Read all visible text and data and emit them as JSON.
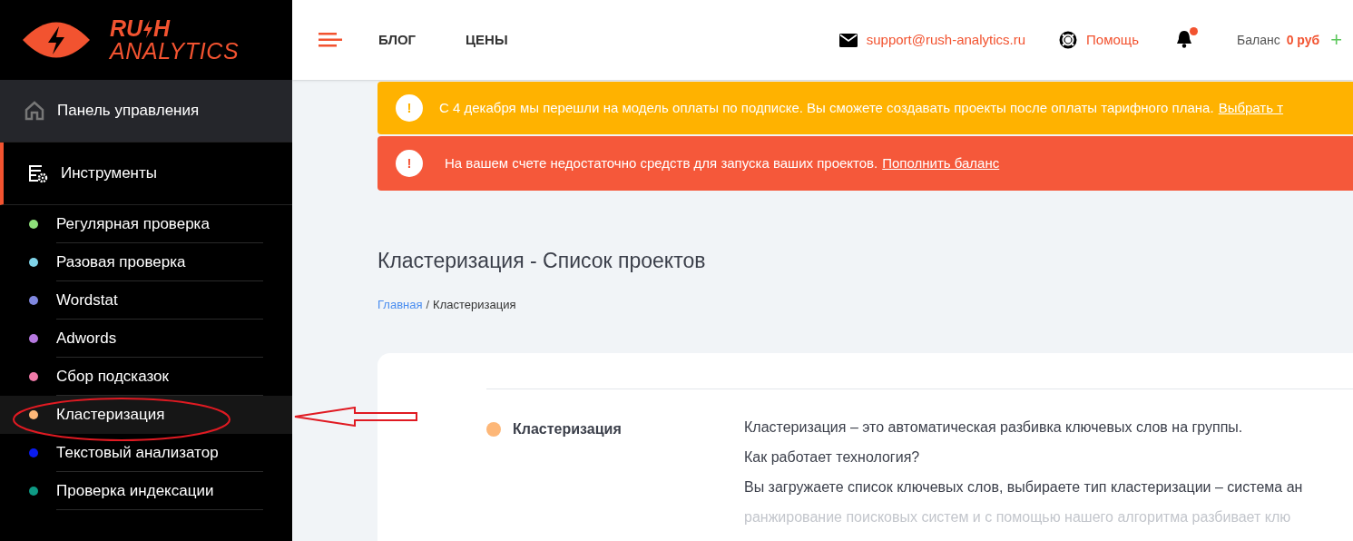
{
  "logo": {
    "line1": "RU",
    "line1b": "H",
    "line2": "ANALYTICS"
  },
  "sidebar": {
    "items": [
      {
        "label": "Панель управления",
        "kind": "home",
        "selected": false
      },
      {
        "label": "Инструменты",
        "kind": "tools",
        "selected": true
      }
    ],
    "tools": [
      {
        "label": "Регулярная проверка",
        "color": "#8ee07a",
        "selected": false
      },
      {
        "label": "Разовая проверка",
        "color": "#7fd3e8",
        "selected": false
      },
      {
        "label": "Wordstat",
        "color": "#8088e0",
        "selected": false
      },
      {
        "label": "Adwords",
        "color": "#b679e0",
        "selected": false
      },
      {
        "label": "Сбор подсказок",
        "color": "#f07aa8",
        "selected": false
      },
      {
        "label": "Кластеризация",
        "color": "#fdb778",
        "selected": true
      },
      {
        "label": "Текстовый анализатор",
        "color": "#0a1cf0",
        "selected": false
      },
      {
        "label": "Проверка индексации",
        "color": "#0e9a84",
        "selected": false
      }
    ]
  },
  "header": {
    "nav": [
      "БЛОГ",
      "ЦЕНЫ"
    ],
    "email": "support@rush-analytics.ru",
    "help": "Помощь",
    "notification_unread": true,
    "balance_label": "Баланс",
    "balance_value": "0 руб",
    "add": "+"
  },
  "alerts": [
    {
      "kind": "warning",
      "icon": "!",
      "text": "С 4 декабря мы перешли на модель оплаты по подписке. Вы сможете создавать проекты после оплаты тарифного плана.",
      "link": "Выбрать т"
    },
    {
      "kind": "danger",
      "icon": "!",
      "text": "На вашем счете недостаточно средств для запуска ваших проектов.",
      "link": "Пополнить баланс"
    }
  ],
  "page": {
    "title": "Кластеризация - Список проектов",
    "breadcrumb_separator": "/",
    "breadcrumb": [
      {
        "label": "Главная",
        "link": true
      },
      {
        "label": "Кластеризация",
        "link": false
      }
    ]
  },
  "info": {
    "name": "Кластеризация",
    "color": "#fdb778",
    "lines": [
      {
        "text": "Кластеризация – это автоматическая разбивка ключевых слов на группы.",
        "faded": false
      },
      {
        "text": "Как работает технология?",
        "faded": false
      },
      {
        "text": "Вы загружаете список ключевых слов, выбираете тип кластеризации – система ан",
        "faded": false
      },
      {
        "text": "ранжирование поисковых систем и с помощью нашего алгоритма разбивает клю",
        "faded": true
      }
    ]
  }
}
